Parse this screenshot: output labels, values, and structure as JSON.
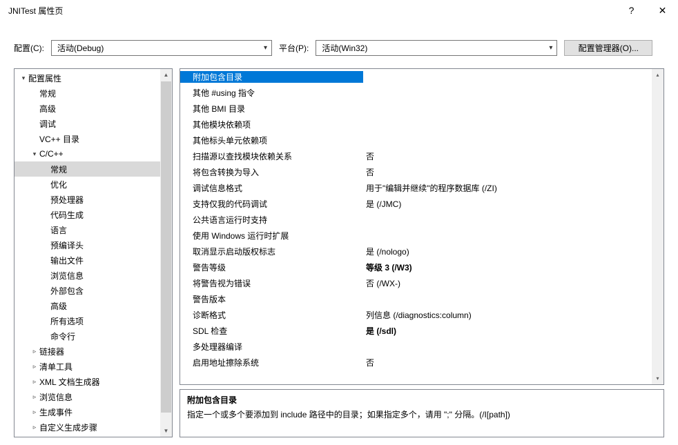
{
  "window": {
    "title": "JNITest 属性页"
  },
  "toolbar": {
    "config_label": "配置(C):",
    "config_value": "活动(Debug)",
    "platform_label": "平台(P):",
    "platform_value": "活动(Win32)",
    "manager_label": "配置管理器(O)..."
  },
  "tree": [
    {
      "label": "配置属性",
      "level": 0,
      "expander": "▾"
    },
    {
      "label": "常规",
      "level": 1,
      "expander": ""
    },
    {
      "label": "高级",
      "level": 1,
      "expander": ""
    },
    {
      "label": "调试",
      "level": 1,
      "expander": ""
    },
    {
      "label": "VC++ 目录",
      "level": 1,
      "expander": ""
    },
    {
      "label": "C/C++",
      "level": 1,
      "expander": "▾"
    },
    {
      "label": "常规",
      "level": 2,
      "expander": "",
      "selected": true
    },
    {
      "label": "优化",
      "level": 2,
      "expander": ""
    },
    {
      "label": "预处理器",
      "level": 2,
      "expander": ""
    },
    {
      "label": "代码生成",
      "level": 2,
      "expander": ""
    },
    {
      "label": "语言",
      "level": 2,
      "expander": ""
    },
    {
      "label": "预编译头",
      "level": 2,
      "expander": ""
    },
    {
      "label": "输出文件",
      "level": 2,
      "expander": ""
    },
    {
      "label": "浏览信息",
      "level": 2,
      "expander": ""
    },
    {
      "label": "外部包含",
      "level": 2,
      "expander": ""
    },
    {
      "label": "高级",
      "level": 2,
      "expander": ""
    },
    {
      "label": "所有选项",
      "level": 2,
      "expander": ""
    },
    {
      "label": "命令行",
      "level": 2,
      "expander": ""
    },
    {
      "label": "链接器",
      "level": 1,
      "expander": "▹"
    },
    {
      "label": "清单工具",
      "level": 1,
      "expander": "▹"
    },
    {
      "label": "XML 文档生成器",
      "level": 1,
      "expander": "▹"
    },
    {
      "label": "浏览信息",
      "level": 1,
      "expander": "▹"
    },
    {
      "label": "生成事件",
      "level": 1,
      "expander": "▹"
    },
    {
      "label": "自定义生成步骤",
      "level": 1,
      "expander": "▹"
    }
  ],
  "grid": [
    {
      "name": "附加包含目录",
      "value": "",
      "selected": true
    },
    {
      "name": "其他 #using 指令",
      "value": ""
    },
    {
      "name": "其他 BMI 目录",
      "value": ""
    },
    {
      "name": "其他模块依赖项",
      "value": ""
    },
    {
      "name": "其他标头单元依赖项",
      "value": ""
    },
    {
      "name": "扫描源以查找模块依赖关系",
      "value": "否"
    },
    {
      "name": "将包含转换为导入",
      "value": "否"
    },
    {
      "name": "调试信息格式",
      "value": "用于\"编辑并继续\"的程序数据库 (/ZI)"
    },
    {
      "name": "支持仅我的代码调试",
      "value": "是 (/JMC)"
    },
    {
      "name": "公共语言运行时支持",
      "value": ""
    },
    {
      "name": "使用 Windows 运行时扩展",
      "value": ""
    },
    {
      "name": "取消显示启动版权标志",
      "value": "是 (/nologo)"
    },
    {
      "name": "警告等级",
      "value": "等级 3 (/W3)",
      "bold": true
    },
    {
      "name": "将警告视为错误",
      "value": "否 (/WX-)"
    },
    {
      "name": "警告版本",
      "value": ""
    },
    {
      "name": "诊断格式",
      "value": "列信息 (/diagnostics:column)"
    },
    {
      "name": "SDL 检查",
      "value": "是 (/sdl)",
      "bold": true
    },
    {
      "name": "多处理器编译",
      "value": ""
    },
    {
      "name": "启用地址擦除系统",
      "value": "否"
    }
  ],
  "desc": {
    "title": "附加包含目录",
    "text": "指定一个或多个要添加到 include 路径中的目录；如果指定多个，请用 \";\" 分隔。(/I[path])"
  }
}
